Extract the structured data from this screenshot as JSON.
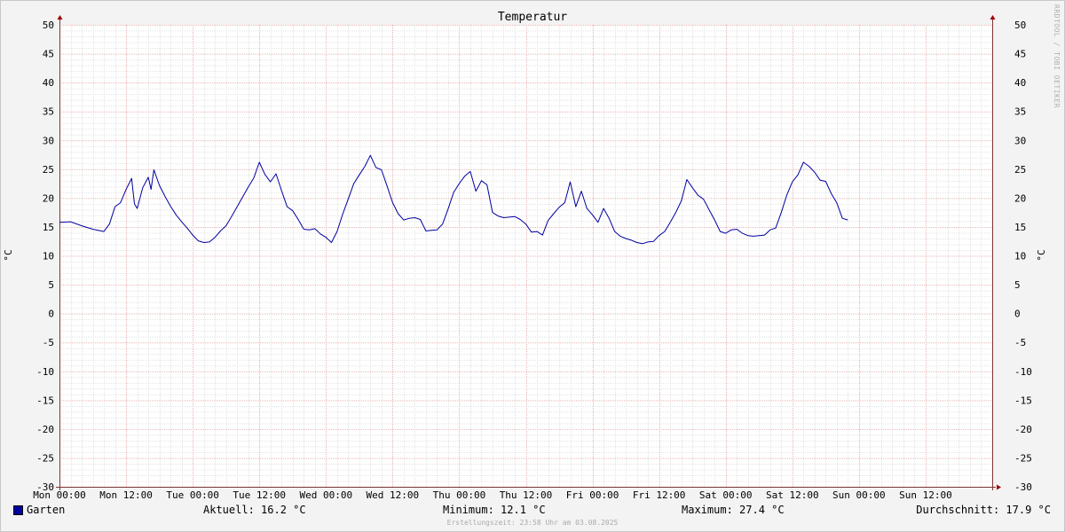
{
  "watermark": "RRDTOOL / TOBI OETIKER",
  "chart_data": {
    "type": "line",
    "title": "Temperatur",
    "ylabel": "°C",
    "ylabel_right": "°C",
    "ylim": [
      -30,
      50
    ],
    "y_ticks": [
      "50",
      "45",
      "40",
      "35",
      "30",
      "25",
      "20",
      "15",
      "10",
      "5",
      "0",
      "-5",
      "-10",
      "-15",
      "-20",
      "-25",
      "-30"
    ],
    "x_ticks": [
      "Mon 00:00",
      "Mon 12:00",
      "Tue 00:00",
      "Tue 12:00",
      "Wed 00:00",
      "Wed 12:00",
      "Thu 00:00",
      "Thu 12:00",
      "Fri 00:00",
      "Fri 12:00",
      "Sat 00:00",
      "Sat 12:00",
      "Sun 00:00",
      "Sun 12:00"
    ],
    "x_hours_range": [
      0,
      168
    ],
    "grid": true,
    "series": [
      {
        "name": "Garten",
        "color": "#0000a0",
        "x_hours": [
          0,
          2,
          4,
          6,
          8,
          9,
          10,
          11,
          12,
          13,
          13.5,
          14,
          15,
          16,
          16.5,
          17,
          18,
          19,
          20,
          21,
          22,
          23,
          24,
          25,
          26,
          27,
          28,
          29,
          30,
          31,
          32,
          33,
          34,
          35,
          36,
          37,
          38,
          39,
          40,
          41,
          42,
          43,
          44,
          45,
          46,
          47,
          48,
          49,
          50,
          51,
          52,
          53,
          54,
          55,
          56,
          57,
          58,
          59,
          60,
          61,
          62,
          63,
          64,
          65,
          66,
          67,
          68,
          69,
          70,
          71,
          72,
          73,
          74,
          75,
          76,
          77,
          78,
          79,
          80,
          81,
          82,
          83,
          84,
          85,
          86,
          87,
          88,
          89,
          90,
          91,
          92,
          93,
          94,
          95,
          96,
          97,
          98,
          99,
          100,
          101,
          102,
          103,
          104,
          105,
          106,
          107,
          108,
          109,
          110,
          111,
          112,
          113,
          114,
          115,
          116,
          117,
          118,
          119,
          120,
          121,
          122,
          123,
          124,
          125,
          126,
          127,
          128,
          129,
          130,
          131,
          132,
          133,
          134,
          135,
          136,
          137,
          138,
          139,
          140,
          141,
          142,
          143,
          144,
          145,
          146,
          147,
          148,
          149,
          150,
          151,
          152,
          153,
          154,
          155,
          156,
          157,
          158,
          159,
          160,
          161,
          162,
          163,
          164,
          165,
          166,
          167,
          168
        ],
        "values": [
          15.8,
          15.9,
          15.2,
          14.6,
          14.2,
          15.5,
          18.5,
          19.2,
          21.5,
          23.4,
          19.0,
          18.2,
          21.8,
          23.6,
          21.5,
          24.9,
          22.2,
          20.3,
          18.6,
          17.1,
          15.9,
          14.8,
          13.6,
          12.6,
          12.3,
          12.4,
          13.2,
          14.3,
          15.2,
          16.8,
          18.5,
          20.2,
          21.9,
          23.5,
          26.2,
          24.1,
          22.8,
          24.2,
          21.3,
          18.5,
          17.8,
          16.3,
          14.6,
          14.5,
          14.7,
          13.8,
          13.2,
          12.3,
          14.2,
          17.2,
          19.8,
          22.5,
          24.0,
          25.5,
          27.4,
          25.3,
          24.9,
          22.1,
          19.2,
          17.3,
          16.2,
          16.5,
          16.6,
          16.3,
          14.3,
          14.4,
          14.5,
          15.5,
          18.1,
          21.0,
          22.5,
          23.8,
          24.6,
          21.2,
          23.0,
          22.3,
          17.5,
          16.9,
          16.6,
          16.7,
          16.8,
          16.3,
          15.5,
          14.1,
          14.2,
          13.6,
          16.1,
          17.3,
          18.4,
          19.2,
          22.8,
          18.5,
          21.2,
          18.2,
          17.1,
          15.8,
          18.2,
          16.5,
          14.2,
          13.4,
          13.0,
          12.7,
          12.3,
          12.1,
          12.4,
          12.5,
          13.5,
          14.2,
          15.8,
          17.5,
          19.5,
          23.2,
          21.8,
          20.5,
          19.8,
          18.0,
          16.2,
          14.2,
          13.9,
          14.5,
          14.6,
          13.9,
          13.5,
          13.4,
          13.5,
          13.6,
          14.5,
          14.8,
          17.5,
          20.5,
          22.8,
          24.0,
          26.2,
          25.5,
          24.5,
          23.1,
          22.9,
          20.8,
          19.2,
          16.5,
          16.2
        ]
      }
    ]
  },
  "legend": {
    "series_label": "Garten",
    "current": "Aktuell: 16.2 °C",
    "minimum": "Minimum: 12.1 °C",
    "maximum": "Maximum: 27.4 °C",
    "average": "Durchschnitt: 17.9 °C"
  },
  "credit": "Erstellungszeit: 23:58 Uhr am 03.08.2025"
}
